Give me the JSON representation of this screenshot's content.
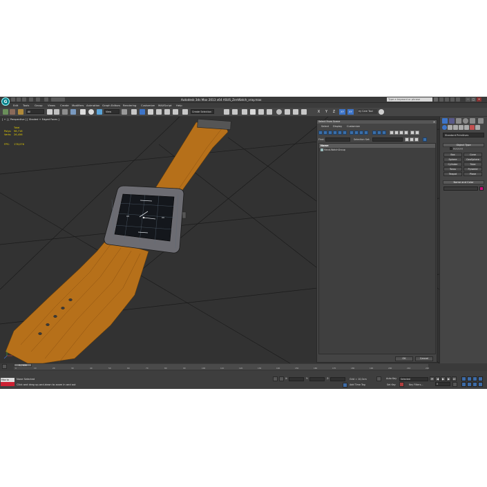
{
  "app": {
    "title": "Autodesk 3ds Max  2013 x64    ASUS_ZenWatch_vray.max",
    "logo_letter": "G",
    "search_placeholder": "Type a keyword or phrase"
  },
  "menu": [
    "Edit",
    "Tools",
    "Group",
    "Views",
    "Create",
    "Modifiers",
    "Animation",
    "Graph Editors",
    "Rendering",
    "Customize",
    "MAXScript",
    "Help"
  ],
  "toolbar": {
    "selection_filter": "All",
    "ref_coord": "View",
    "named_selection": "Create Selection",
    "axis": [
      "X",
      "Y",
      "Z",
      "XY",
      "XY"
    ],
    "key_tool_label": "ey Care Tool"
  },
  "viewport": {
    "label": "[ + ] [ Perspective ] [ Shaded + Edged Faces ]",
    "stats": [
      {
        "label": "",
        "value": "Total"
      },
      {
        "label": "Polys:",
        "value": "98,716"
      },
      {
        "label": "Verts:",
        "value": "26,456"
      }
    ],
    "fps_label": "FPS:",
    "fps_value": "178,076"
  },
  "scene_explorer": {
    "title": "Select From Scene",
    "close": "✕",
    "menu": [
      "Select",
      "Display",
      "Customize"
    ],
    "find_label": "Find:",
    "selection_set_label": "Selection Set:",
    "column_header": "Name",
    "rows": [
      "Hand-WatchGroup"
    ],
    "ok": "OK",
    "cancel": "Cancel"
  },
  "command_panel": {
    "category": "Standard Primitives",
    "object_type": "Object Type",
    "autogrid": "AutoGrid",
    "primitives": [
      "Box",
      "Cone",
      "Sphere",
      "GeoSphere",
      "Cylinder",
      "Tube",
      "Torus",
      "Pyramid",
      "Teapot",
      "Plane"
    ],
    "name_and_color": "Name and Color",
    "color": "#cc0e7c"
  },
  "timeline": {
    "slider": "0 / 100",
    "ticks": [
      "0",
      "10",
      "20",
      "30",
      "40",
      "50",
      "60",
      "70",
      "80",
      "90",
      "100",
      "110",
      "120",
      "130",
      "140",
      "150",
      "160",
      "170",
      "180",
      "190",
      "200",
      "210",
      "220"
    ]
  },
  "status": {
    "maxscript": "Max to",
    "selection": "None Selected",
    "hint": "Click and drag up-and-down to zoom in and out",
    "x_label": "X:",
    "y_label": "Y:",
    "z_label": "Z:",
    "grid": "Grid = 10,0cm",
    "auto_key": "Auto Key",
    "set_key": "Set Key",
    "key_mode": "Selected",
    "key_filters": "Key Filters...",
    "add_time_tag": "Add Time Tag",
    "frame": "0"
  }
}
